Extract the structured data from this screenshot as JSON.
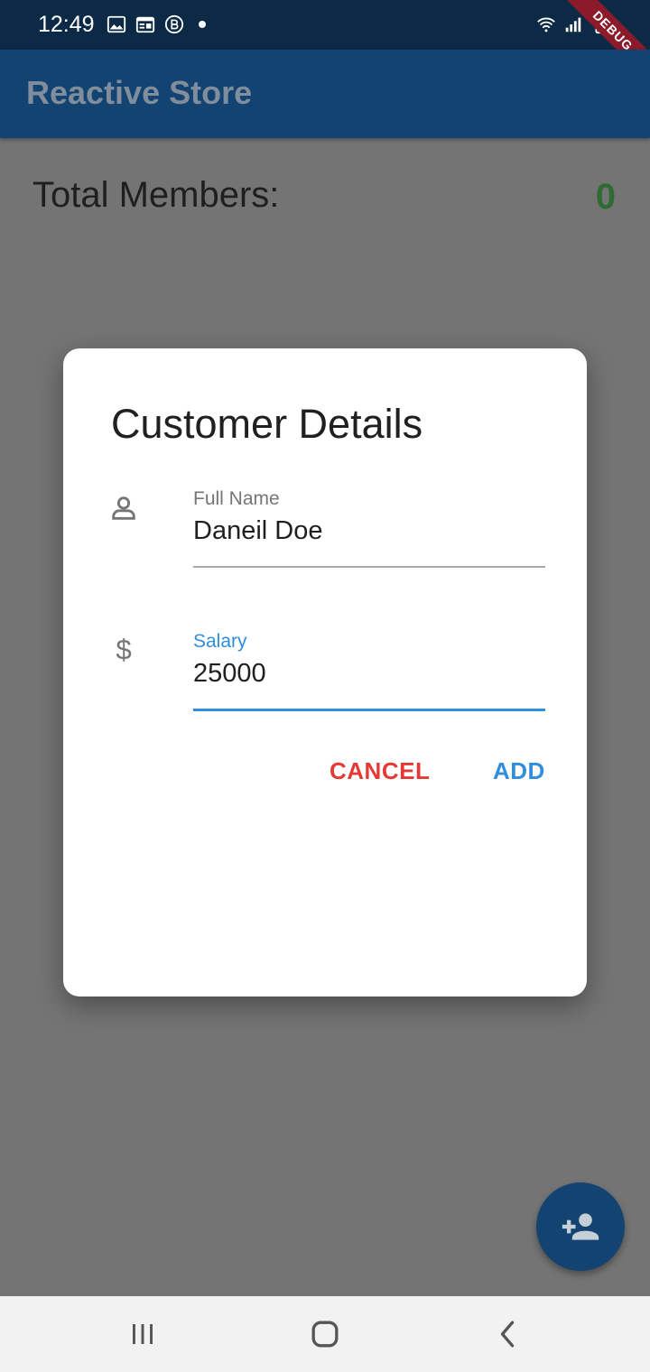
{
  "status_bar": {
    "time": "12:49",
    "left_icons": [
      "image-icon",
      "calendar-icon",
      "b-badge-icon",
      "notification-dot"
    ],
    "right_icons": [
      "wifi-icon",
      "signal-icon",
      "battery-icon"
    ]
  },
  "debug_banner": "DEBUG",
  "app_bar": {
    "title": "Reactive Store"
  },
  "main": {
    "total_label": "Total Members:",
    "total_count": "0"
  },
  "dialog": {
    "title": "Customer Details",
    "fields": [
      {
        "label": "Full Name",
        "value": "Daneil Doe",
        "icon": "person-icon"
      },
      {
        "label": "Salary",
        "value": "25000",
        "icon": "dollar-icon"
      }
    ],
    "cancel_label": "CANCEL",
    "add_label": "ADD"
  },
  "fab": {
    "icon": "person-add-icon"
  },
  "nav_bar": {
    "buttons": [
      "recent-apps-icon",
      "home-icon",
      "back-icon"
    ]
  },
  "colors": {
    "app_bar": "#124371",
    "status_bar": "#0c2a45",
    "scrim_background": "#747474",
    "accent": "#2f8fde",
    "cancel": "#e53935",
    "count": "#2e6b33"
  }
}
